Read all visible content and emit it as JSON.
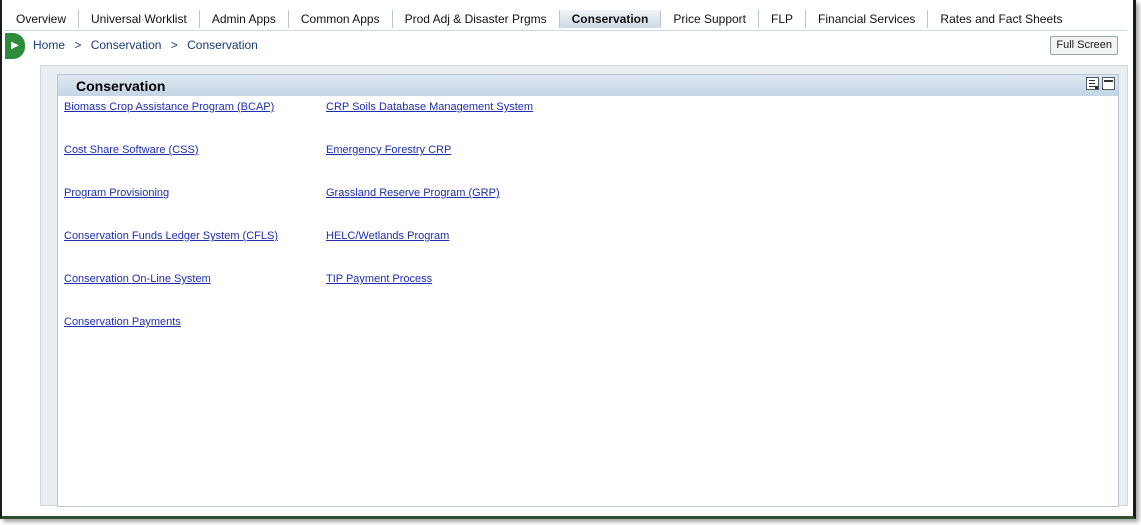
{
  "nav": {
    "tabs": [
      {
        "label": "Overview",
        "active": false
      },
      {
        "label": "Universal Worklist",
        "active": false
      },
      {
        "label": "Admin Apps",
        "active": false
      },
      {
        "label": "Common Apps",
        "active": false
      },
      {
        "label": "Prod Adj & Disaster Prgms",
        "active": false
      },
      {
        "label": "Conservation",
        "active": true
      },
      {
        "label": "Price Support",
        "active": false
      },
      {
        "label": "FLP",
        "active": false
      },
      {
        "label": "Financial Services",
        "active": false
      },
      {
        "label": "Rates and Fact Sheets",
        "active": false
      }
    ]
  },
  "breadcrumb": {
    "items": [
      "Home",
      "Conservation",
      "Conservation"
    ],
    "separator": ">"
  },
  "fullscreen_label": "Full Screen",
  "panel": {
    "title": "Conservation",
    "col1": [
      "Biomass Crop Assistance Program (BCAP)",
      "Cost Share Software (CSS)",
      "Program Provisioning",
      "Conservation Funds Ledger System (CFLS)",
      "Conservation On-Line System",
      "Conservation Payments"
    ],
    "col2": [
      "CRP Soils Database Management System",
      "Emergency Forestry CRP",
      "Grassland Reserve Program (GRP)",
      "HELC/Wetlands Program",
      "TIP Payment Process"
    ]
  },
  "colors": {
    "link": "#1e2eb0",
    "header_bg": "#c5d5e5",
    "toggle_green": "#2e8b3a"
  }
}
